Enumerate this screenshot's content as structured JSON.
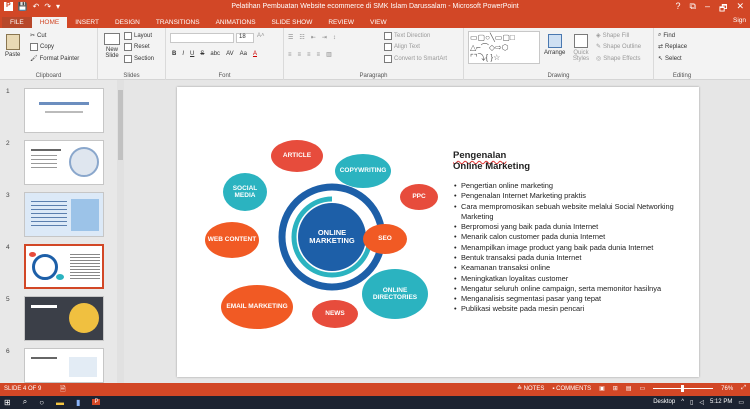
{
  "window": {
    "title": "Pelatihan Pembuatan Website ecommerce di SMK Islam Darussalam - Microsoft PowerPoint",
    "help": "?",
    "restore": "⧉",
    "minimize": "–",
    "maximize": "🗗",
    "close": "✕",
    "user": "Sign"
  },
  "qat": {
    "save": "💾",
    "undo": "↶",
    "redo": "↷",
    "customize": "▾"
  },
  "tabs": [
    "FILE",
    "HOME",
    "INSERT",
    "DESIGN",
    "TRANSITIONS",
    "ANIMATIONS",
    "SLIDE SHOW",
    "REVIEW",
    "VIEW"
  ],
  "ribbon": {
    "clipboard": {
      "label": "Clipboard",
      "paste": "Paste",
      "cut": "Cut",
      "copy": "Copy",
      "format_painter": "Format Painter"
    },
    "slides": {
      "label": "Slides",
      "new_slide": "New Slide",
      "layout": "Layout",
      "reset": "Reset",
      "section": "Section"
    },
    "font": {
      "label": "Font",
      "font_size": "18",
      "bold": "B",
      "italic": "I",
      "underline": "U",
      "strike": "S",
      "shadow": "abc",
      "spacing": "AV",
      "case": "Aa",
      "color": "A"
    },
    "paragraph": {
      "label": "Paragraph",
      "text_direction": "Text Direction",
      "align_text": "Align Text",
      "convert": "Convert to SmartArt"
    },
    "drawing": {
      "label": "Drawing",
      "arrange": "Arrange",
      "quick_styles": "Quick Styles",
      "shape_fill": "Shape Fill",
      "shape_outline": "Shape Outline",
      "shape_effects": "Shape Effects"
    },
    "editing": {
      "label": "Editing",
      "find": "Find",
      "replace": "Replace",
      "select": "Select"
    }
  },
  "thumbnails": [
    {
      "num": "1"
    },
    {
      "num": "2"
    },
    {
      "num": "3"
    },
    {
      "num": "4"
    },
    {
      "num": "5"
    },
    {
      "num": "6"
    }
  ],
  "slide": {
    "center": "ONLINE MARKETING",
    "bubbles": {
      "article": "ARTICLE",
      "copywriting": "COPYWRITING",
      "ppc": "PPC",
      "seo": "SEO",
      "online_directories": "ONLINE DIRECTORIES",
      "news": "NEWS",
      "email_marketing": "EMAIL MARKETING",
      "web_content": "WEB CONTENT",
      "social_media": "SOCIAL MEDIA"
    },
    "heading_line1": "Pengenalan",
    "heading_line2": "Online Marketing",
    "bullets": [
      "Pengertian online marketing",
      "Pengenalan Internet Marketing praktis",
      "Cara mempromosikan sebuah website melalui Social Networking Marketing",
      "Berpromosi yang baik pada dunia Internet",
      "Menarik calon customer pada dunia Internet",
      "Menampilkan image product yang baik pada dunia Internet",
      "Bentuk transaksi pada dunia Internet",
      "Keamanan transaksi online",
      "Meningkatkan loyalitas customer",
      "Mengatur seluruh online campaign, serta memonitor hasilnya",
      "Menganalisis segmentasi pasar yang tepat",
      "Publikasi website pada mesin pencari"
    ]
  },
  "status": {
    "slide": "SLIDE 4 OF 9",
    "notes": "NOTES",
    "comments": "COMMENTS",
    "zoom": "76%"
  },
  "taskbar": {
    "desktop": "Desktop",
    "time": "5:12 PM"
  },
  "colors": {
    "accent": "#d24726",
    "red": "#e74c3c",
    "teal": "#2bb3c0",
    "blue": "#1d5fa8"
  }
}
